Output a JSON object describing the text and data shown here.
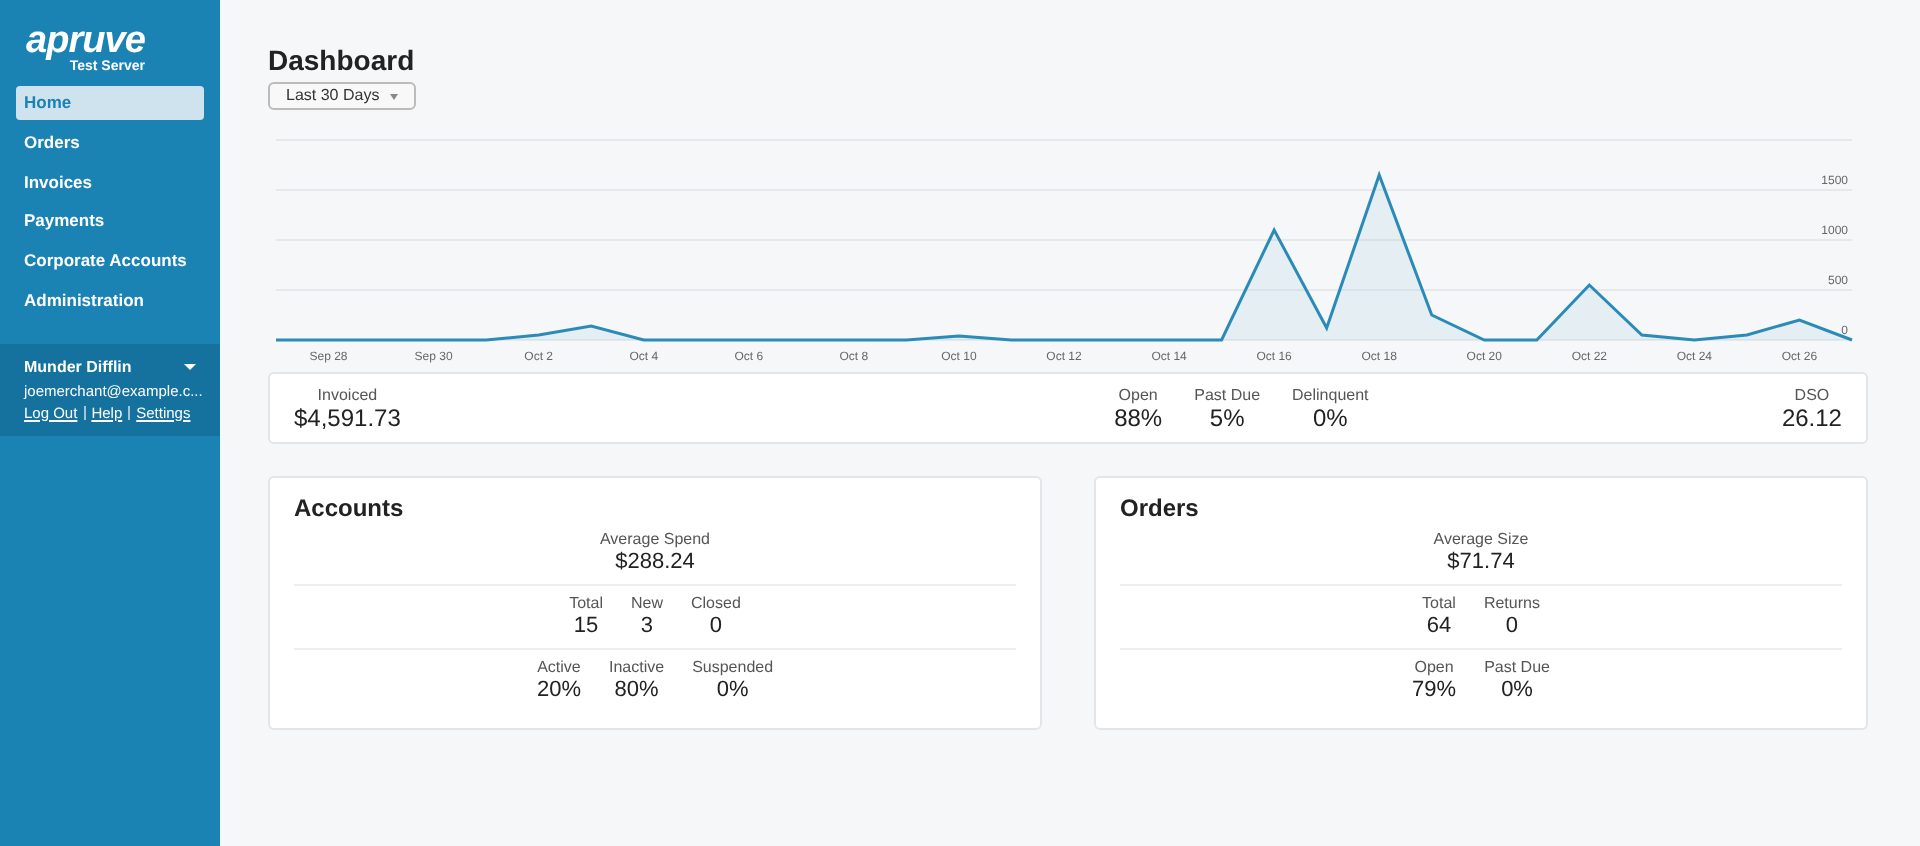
{
  "sidebar": {
    "logo": "apruve",
    "logo_subtitle": "Test Server",
    "items": [
      {
        "label": "Home",
        "selected": true
      },
      {
        "label": "Orders",
        "selected": false
      },
      {
        "label": "Invoices",
        "selected": false
      },
      {
        "label": "Payments",
        "selected": false
      },
      {
        "label": "Corporate Accounts",
        "selected": false
      },
      {
        "label": "Administration",
        "selected": false
      }
    ],
    "user": {
      "name": "Munder Difflin",
      "email": "joemerchant@example.c...",
      "links": [
        "Log Out",
        "Help",
        "Settings"
      ]
    }
  },
  "page_title": "Dashboard",
  "range_select": {
    "value": "Last 30 Days"
  },
  "chart_data": {
    "type": "area",
    "grid": true,
    "categories": [
      null,
      "Sep 28",
      null,
      "Sep 30",
      null,
      "Oct 2",
      null,
      "Oct 4",
      null,
      "Oct 6",
      null,
      "Oct 8",
      null,
      "Oct 10",
      null,
      "Oct 12",
      null,
      "Oct 14",
      null,
      "Oct 16",
      null,
      "Oct 18",
      null,
      "Oct 20",
      null,
      "Oct 22",
      null,
      "Oct 24",
      null,
      "Oct 26",
      null
    ],
    "series": [
      {
        "color": "#2b8bb8",
        "values": [
          0,
          0,
          0,
          0,
          0,
          50,
          140,
          0,
          0,
          0,
          0,
          0,
          0,
          40,
          0,
          0,
          0,
          0,
          0,
          1100,
          120,
          1650,
          250,
          0,
          0,
          550,
          50,
          0,
          50,
          200,
          0
        ]
      }
    ],
    "ylim": [
      0,
      2000
    ],
    "yticks": [
      0,
      500,
      1000,
      1500
    ]
  },
  "summary": {
    "left": {
      "label": "Invoiced",
      "value": "$4,591.73"
    },
    "middle": [
      {
        "label": "Open",
        "value": "88%"
      },
      {
        "label": "Past Due",
        "value": "5%"
      },
      {
        "label": "Delinquent",
        "value": "0%"
      }
    ],
    "right": {
      "label": "DSO",
      "value": "26.12"
    }
  },
  "cards": [
    {
      "title": "Accounts",
      "sections": [
        {
          "stats": [
            {
              "label": "Average Spend",
              "value": "$288.24"
            }
          ]
        },
        {
          "stats": [
            {
              "label": "Total",
              "value": "15"
            },
            {
              "label": "New",
              "value": "3"
            },
            {
              "label": "Closed",
              "value": "0"
            }
          ]
        },
        {
          "stats": [
            {
              "label": "Active",
              "value": "20%"
            },
            {
              "label": "Inactive",
              "value": "80%"
            },
            {
              "label": "Suspended",
              "value": "0%"
            }
          ]
        }
      ]
    },
    {
      "title": "Orders",
      "sections": [
        {
          "stats": [
            {
              "label": "Average Size",
              "value": "$71.74"
            }
          ]
        },
        {
          "stats": [
            {
              "label": "Total",
              "value": "64"
            },
            {
              "label": "Returns",
              "value": "0"
            }
          ]
        },
        {
          "stats": [
            {
              "label": "Open",
              "value": "79%"
            },
            {
              "label": "Past Due",
              "value": "0%"
            }
          ]
        }
      ]
    }
  ]
}
